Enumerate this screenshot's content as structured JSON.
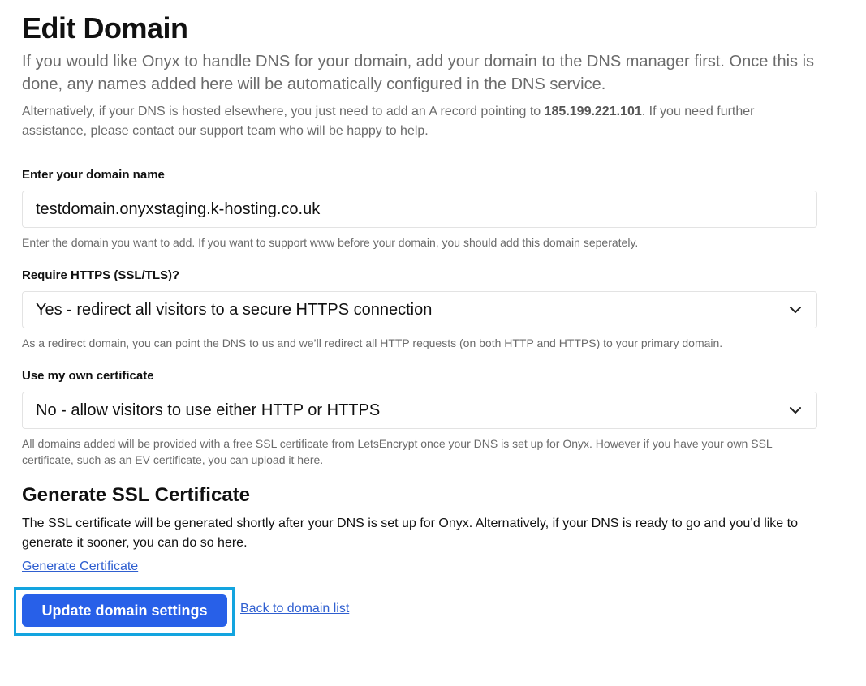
{
  "page": {
    "title": "Edit Domain",
    "lead": "If you would like Onyx to handle DNS for your domain, add your domain to the DNS manager first. Once this is done, any names added here will be automatically configured in the DNS service.",
    "intro_before": "Alternatively, if your DNS is hosted elsewhere, you just need to add an A record pointing to ",
    "intro_ip": "185.199.221.101",
    "intro_after": ". If you need further assistance, please contact our support team who will be happy to help."
  },
  "domain_field": {
    "label": "Enter your domain name",
    "value": "testdomain.onyxstaging.k-hosting.co.uk",
    "hint": "Enter the domain you want to add. If you want to support www before your domain, you should add this domain seperately."
  },
  "https_field": {
    "label": "Require HTTPS (SSL/TLS)?",
    "selected": "Yes - redirect all visitors to a secure HTTPS connection",
    "hint": "As a redirect domain, you can point the DNS to us and we’ll redirect all HTTP requests (on both HTTP and HTTPS) to your primary domain."
  },
  "cert_field": {
    "label": "Use my own certificate",
    "selected": "No - allow visitors to use either HTTP or HTTPS",
    "hint": "All domains added will be provided with a free SSL certificate from LetsEncrypt once your DNS is set up for Onyx. However if you have your own SSL certificate, such as an EV certificate, you can upload it here."
  },
  "ssl_section": {
    "title": "Generate SSL Certificate",
    "text": "The SSL certificate will be generated shortly after your DNS is set up for Onyx. Alternatively, if your DNS is ready to go and you’d like to generate it sooner, you can do so here.",
    "link": "Generate Certificate"
  },
  "actions": {
    "primary": "Update domain settings",
    "back": "Back to domain list"
  },
  "colors": {
    "primary": "#2860e8",
    "link": "#2f5fd0",
    "focus": "#13a4df",
    "muted_text": "#6b6b6b"
  }
}
